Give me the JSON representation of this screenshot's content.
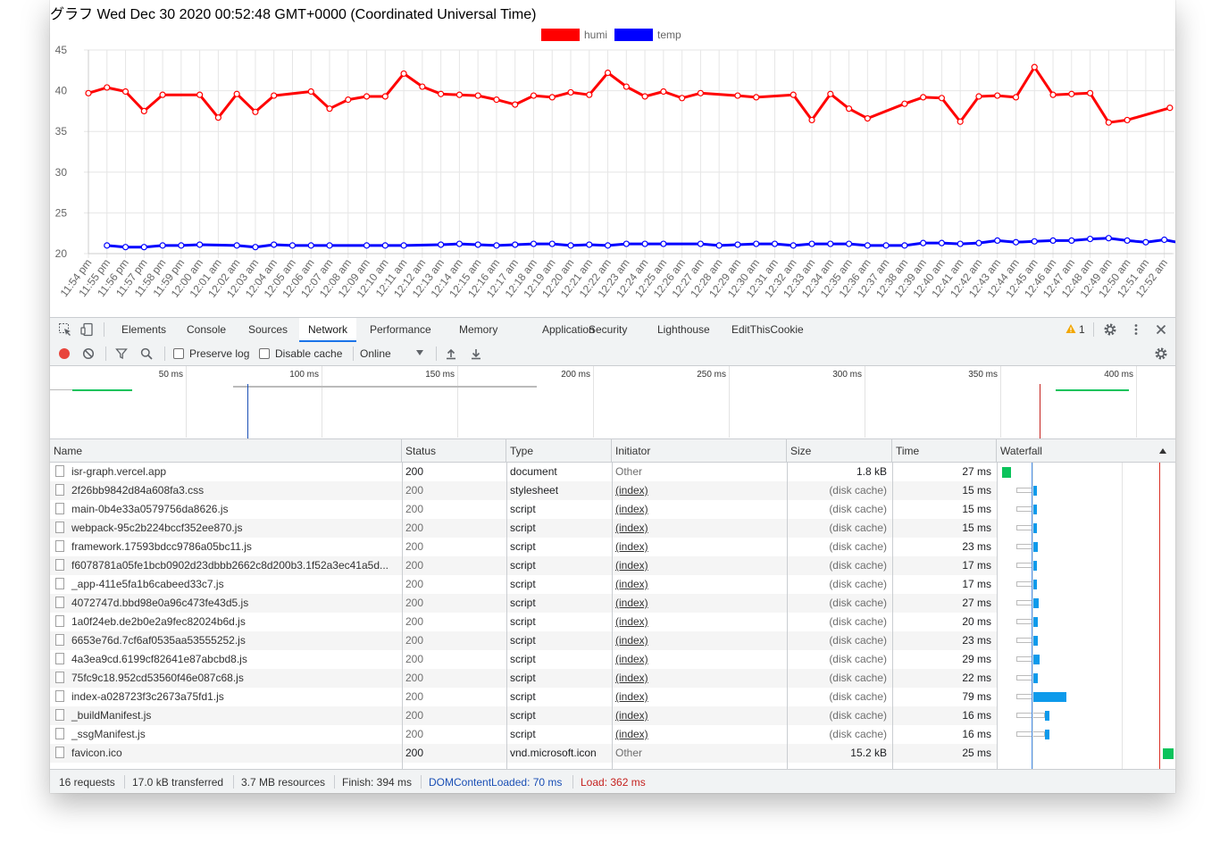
{
  "page": {
    "title": "グラフ Wed Dec 30 2020 00:52:48 GMT+0000 (Coordinated Universal Time)"
  },
  "chart_data": {
    "type": "line",
    "legend": {
      "position": "top",
      "items": [
        {
          "name": "humi",
          "color": "#ff0000"
        },
        {
          "name": "temp",
          "color": "#0000ff"
        }
      ]
    },
    "ylim": [
      20,
      45
    ],
    "yticks": [
      "45",
      "40",
      "35",
      "30",
      "25",
      "20"
    ],
    "grid": true,
    "categories": [
      "11:54 pm",
      "11:55 pm",
      "11:56 pm",
      "11:57 pm",
      "11:58 pm",
      "11:59 pm",
      "12:00 am",
      "12:01 am",
      "12:02 am",
      "12:03 am",
      "12:04 am",
      "12:05 am",
      "12:06 am",
      "12:07 am",
      "12:08 am",
      "12:09 am",
      "12:10 am",
      "12:11 am",
      "12:12 am",
      "12:13 am",
      "12:14 am",
      "12:15 am",
      "12:16 am",
      "12:17 am",
      "12:18 am",
      "12:19 am",
      "12:20 am",
      "12:21 am",
      "12:22 am",
      "12:23 am",
      "12:24 am",
      "12:25 am",
      "12:26 am",
      "12:27 am",
      "12:28 am",
      "12:29 am",
      "12:30 am",
      "12:31 am",
      "12:32 am",
      "12:33 am",
      "12:34 am",
      "12:35 am",
      "12:36 am",
      "12:37 am",
      "12:38 am",
      "12:39 am",
      "12:40 am",
      "12:41 am",
      "12:42 am",
      "12:43 am",
      "12:44 am",
      "12:45 am",
      "12:46 am",
      "12:47 am",
      "12:48 am",
      "12:49 am",
      "12:50 am",
      "12:51 am",
      "12:52 am"
    ],
    "humi": [
      {
        "x": 0,
        "y": 39.7
      },
      {
        "x": 1,
        "y": 40.4
      },
      {
        "x": 2,
        "y": 39.9
      },
      {
        "x": 3,
        "y": 37.5
      },
      {
        "x": 4,
        "y": 39.5
      },
      {
        "x": 6,
        "y": 39.5
      },
      {
        "x": 7,
        "y": 36.7
      },
      {
        "x": 8,
        "y": 39.6
      },
      {
        "x": 9,
        "y": 37.4
      },
      {
        "x": 10,
        "y": 39.4
      },
      {
        "x": 12,
        "y": 39.9
      },
      {
        "x": 13,
        "y": 37.8
      },
      {
        "x": 14,
        "y": 38.9
      },
      {
        "x": 15,
        "y": 39.3
      },
      {
        "x": 16,
        "y": 39.3
      },
      {
        "x": 17,
        "y": 42.1
      },
      {
        "x": 18,
        "y": 40.5
      },
      {
        "x": 19,
        "y": 39.6
      },
      {
        "x": 20,
        "y": 39.5
      },
      {
        "x": 21,
        "y": 39.4
      },
      {
        "x": 22,
        "y": 38.9
      },
      {
        "x": 23,
        "y": 38.3
      },
      {
        "x": 24,
        "y": 39.4
      },
      {
        "x": 25,
        "y": 39.2
      },
      {
        "x": 26,
        "y": 39.8
      },
      {
        "x": 27,
        "y": 39.5
      },
      {
        "x": 28,
        "y": 42.2
      },
      {
        "x": 29,
        "y": 40.5
      },
      {
        "x": 30,
        "y": 39.3
      },
      {
        "x": 31,
        "y": 39.9
      },
      {
        "x": 32,
        "y": 39.1
      },
      {
        "x": 33,
        "y": 39.7
      },
      {
        "x": 35,
        "y": 39.4
      },
      {
        "x": 36,
        "y": 39.2
      },
      {
        "x": 38,
        "y": 39.5
      },
      {
        "x": 39,
        "y": 36.4
      },
      {
        "x": 40,
        "y": 39.6
      },
      {
        "x": 41,
        "y": 37.8
      },
      {
        "x": 42,
        "y": 36.6
      },
      {
        "x": 44,
        "y": 38.4
      },
      {
        "x": 45,
        "y": 39.2
      },
      {
        "x": 46,
        "y": 39.1
      },
      {
        "x": 47,
        "y": 36.2
      },
      {
        "x": 48,
        "y": 39.3
      },
      {
        "x": 49,
        "y": 39.4
      },
      {
        "x": 50,
        "y": 39.2
      },
      {
        "x": 51,
        "y": 42.9
      },
      {
        "x": 52,
        "y": 39.5
      },
      {
        "x": 53,
        "y": 39.6
      },
      {
        "x": 54,
        "y": 39.7
      },
      {
        "x": 55,
        "y": 36.1
      },
      {
        "x": 56,
        "y": 36.4
      },
      {
        "x": 58.3,
        "y": 37.9
      }
    ],
    "temp": [
      {
        "x": 1,
        "y": 21.0
      },
      {
        "x": 2,
        "y": 20.8
      },
      {
        "x": 3,
        "y": 20.8
      },
      {
        "x": 4,
        "y": 21.0
      },
      {
        "x": 5,
        "y": 21.0
      },
      {
        "x": 6,
        "y": 21.1
      },
      {
        "x": 8,
        "y": 21.0
      },
      {
        "x": 9,
        "y": 20.8
      },
      {
        "x": 10,
        "y": 21.1
      },
      {
        "x": 11,
        "y": 21.0
      },
      {
        "x": 12,
        "y": 21.0
      },
      {
        "x": 13,
        "y": 21.0
      },
      {
        "x": 15,
        "y": 21.0
      },
      {
        "x": 16,
        "y": 21.0
      },
      {
        "x": 17,
        "y": 21.0
      },
      {
        "x": 19,
        "y": 21.1
      },
      {
        "x": 20,
        "y": 21.2
      },
      {
        "x": 21,
        "y": 21.1
      },
      {
        "x": 22,
        "y": 21.0
      },
      {
        "x": 23,
        "y": 21.1
      },
      {
        "x": 24,
        "y": 21.2
      },
      {
        "x": 25,
        "y": 21.2
      },
      {
        "x": 26,
        "y": 21.0
      },
      {
        "x": 27,
        "y": 21.1
      },
      {
        "x": 28,
        "y": 21.0
      },
      {
        "x": 29,
        "y": 21.2
      },
      {
        "x": 30,
        "y": 21.2
      },
      {
        "x": 31,
        "y": 21.2
      },
      {
        "x": 33,
        "y": 21.2
      },
      {
        "x": 34,
        "y": 21.0
      },
      {
        "x": 35,
        "y": 21.1
      },
      {
        "x": 36,
        "y": 21.2
      },
      {
        "x": 37,
        "y": 21.2
      },
      {
        "x": 38,
        "y": 21.0
      },
      {
        "x": 39,
        "y": 21.2
      },
      {
        "x": 40,
        "y": 21.2
      },
      {
        "x": 41,
        "y": 21.2
      },
      {
        "x": 42,
        "y": 21.0
      },
      {
        "x": 43,
        "y": 21.0
      },
      {
        "x": 44,
        "y": 21.0
      },
      {
        "x": 45,
        "y": 21.3
      },
      {
        "x": 46,
        "y": 21.3
      },
      {
        "x": 47,
        "y": 21.2
      },
      {
        "x": 48,
        "y": 21.3
      },
      {
        "x": 49,
        "y": 21.6
      },
      {
        "x": 50,
        "y": 21.4
      },
      {
        "x": 51,
        "y": 21.5
      },
      {
        "x": 52,
        "y": 21.6
      },
      {
        "x": 53,
        "y": 21.6
      },
      {
        "x": 54,
        "y": 21.8
      },
      {
        "x": 55,
        "y": 21.9
      },
      {
        "x": 56,
        "y": 21.6
      },
      {
        "x": 57,
        "y": 21.4
      },
      {
        "x": 58,
        "y": 21.7
      },
      {
        "x": 58.9,
        "y": 21.3
      }
    ]
  },
  "devtools": {
    "tabs": [
      "Elements",
      "Console",
      "Sources",
      "Network",
      "Performance",
      "Memory",
      "Application",
      "Security",
      "Lighthouse",
      "EditThisCookie"
    ],
    "active_tab": "Network",
    "warning_count": "1",
    "toolbar": {
      "preserve_log": "Preserve log",
      "disable_cache": "Disable cache",
      "throttle": "Online"
    },
    "overview_labels": [
      "50 ms",
      "100 ms",
      "150 ms",
      "200 ms",
      "250 ms",
      "300 ms",
      "350 ms",
      "400 ms"
    ],
    "columns": {
      "name": "Name",
      "status": "Status",
      "type": "Type",
      "initiator": "Initiator",
      "size": "Size",
      "time": "Time",
      "waterfall": "Waterfall"
    },
    "requests": [
      {
        "name": "isr-graph.vercel.app",
        "status": "200",
        "type": "document",
        "initiator": "Other",
        "size": "1.8 kB",
        "time": "27 ms",
        "start_ms": 2,
        "dur_ms": 10
      },
      {
        "name": "2f26bb9842d84a608fa3.css",
        "status": "200",
        "type": "stylesheet",
        "initiator": "(index)",
        "size": "(disk cache)",
        "time": "15 ms",
        "start_ms": 48,
        "dur_ms": 15
      },
      {
        "name": "main-0b4e33a0579756da8626.js",
        "status": "200",
        "type": "script",
        "initiator": "(index)",
        "size": "(disk cache)",
        "time": "15 ms",
        "start_ms": 48,
        "dur_ms": 15
      },
      {
        "name": "webpack-95c2b224bccf352ee870.js",
        "status": "200",
        "type": "script",
        "initiator": "(index)",
        "size": "(disk cache)",
        "time": "15 ms",
        "start_ms": 48,
        "dur_ms": 15
      },
      {
        "name": "framework.17593bdcc9786a05bc11.js",
        "status": "200",
        "type": "script",
        "initiator": "(index)",
        "size": "(disk cache)",
        "time": "23 ms",
        "start_ms": 48,
        "dur_ms": 23
      },
      {
        "name": "f6078781a05fe1bcb0902d23dbbb2662c8d200b3.1f52a3ec41a5d...",
        "status": "200",
        "type": "script",
        "initiator": "(index)",
        "size": "(disk cache)",
        "time": "17 ms",
        "start_ms": 48,
        "dur_ms": 17
      },
      {
        "name": "_app-411e5fa1b6cabeed33c7.js",
        "status": "200",
        "type": "script",
        "initiator": "(index)",
        "size": "(disk cache)",
        "time": "17 ms",
        "start_ms": 48,
        "dur_ms": 17
      },
      {
        "name": "4072747d.bbd98e0a96c473fe43d5.js",
        "status": "200",
        "type": "script",
        "initiator": "(index)",
        "size": "(disk cache)",
        "time": "27 ms",
        "start_ms": 48,
        "dur_ms": 27
      },
      {
        "name": "1a0f24eb.de2b0e2a9fec82024b6d.js",
        "status": "200",
        "type": "script",
        "initiator": "(index)",
        "size": "(disk cache)",
        "time": "20 ms",
        "start_ms": 48,
        "dur_ms": 20
      },
      {
        "name": "6653e76d.7cf6af0535aa53555252.js",
        "status": "200",
        "type": "script",
        "initiator": "(index)",
        "size": "(disk cache)",
        "time": "23 ms",
        "start_ms": 48,
        "dur_ms": 23
      },
      {
        "name": "4a3ea9cd.6199cf82641e87abcbd8.js",
        "status": "200",
        "type": "script",
        "initiator": "(index)",
        "size": "(disk cache)",
        "time": "29 ms",
        "start_ms": 48,
        "dur_ms": 29
      },
      {
        "name": "75fc9c18.952cd53560f46e087c68.js",
        "status": "200",
        "type": "script",
        "initiator": "(index)",
        "size": "(disk cache)",
        "time": "22 ms",
        "start_ms": 48,
        "dur_ms": 22
      },
      {
        "name": "index-a028723f3c2673a75fd1.js",
        "status": "200",
        "type": "script",
        "initiator": "(index)",
        "size": "(disk cache)",
        "time": "79 ms",
        "start_ms": 48,
        "dur_ms": 79
      },
      {
        "name": "_buildManifest.js",
        "status": "200",
        "type": "script",
        "initiator": "(index)",
        "size": "(disk cache)",
        "time": "16 ms",
        "start_ms": 48,
        "dur_ms": 16
      },
      {
        "name": "_ssgManifest.js",
        "status": "200",
        "type": "script",
        "initiator": "(index)",
        "size": "(disk cache)",
        "time": "16 ms",
        "start_ms": 48,
        "dur_ms": 16
      },
      {
        "name": "favicon.ico",
        "status": "200",
        "type": "vnd.microsoft.icon",
        "initiator": "Other",
        "size": "15.2 kB",
        "time": "25 ms",
        "start_ms": 382,
        "dur_ms": 12
      }
    ],
    "status_bar": {
      "requests": "16 requests",
      "transferred": "17.0 kB transferred",
      "resources": "3.7 MB resources",
      "finish": "Finish: 394 ms",
      "dom_content_loaded": "DOMContentLoaded: 70 ms",
      "load": "Load: 362 ms"
    },
    "colors": {
      "accent": "#1a73e8",
      "dcl": "#1a4fb5",
      "load": "#c5221f",
      "bar_blue": "#0d9aeb",
      "bar_green": "#0bc35b",
      "record": "#e8453c"
    }
  }
}
